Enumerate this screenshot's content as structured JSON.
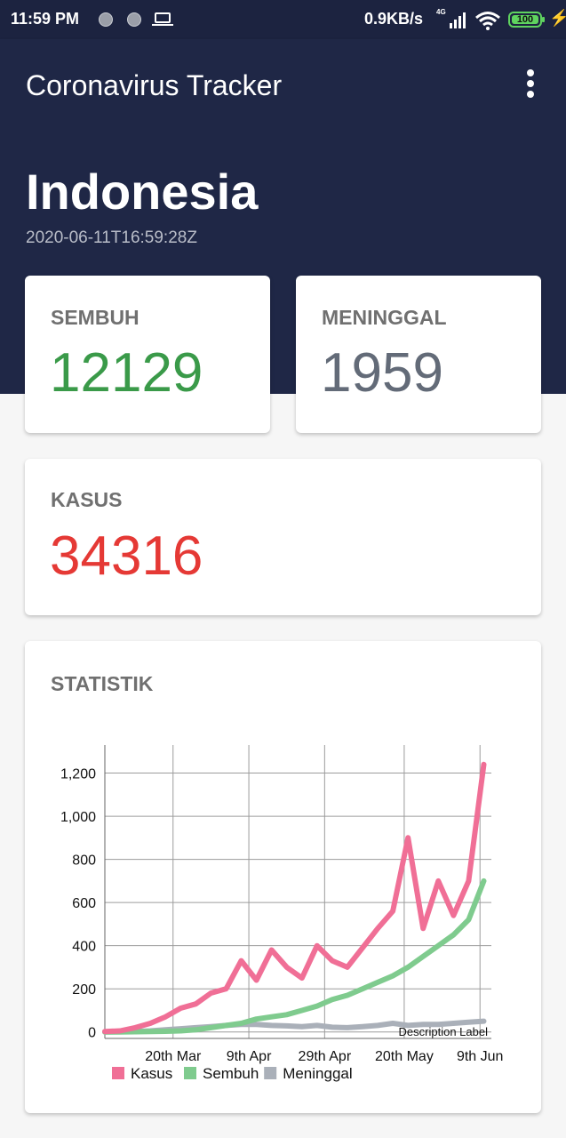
{
  "status_bar": {
    "time": "11:59 PM",
    "speed": "0.9KB/s",
    "network": "4G",
    "battery": "100"
  },
  "app_bar": {
    "title": "Coronavirus Tracker",
    "menu_icon": "more-vert-icon"
  },
  "header": {
    "country": "Indonesia",
    "updated": "2020-06-11T16:59:28Z"
  },
  "stats": {
    "recovered": {
      "label": "SEMBUH",
      "value": "12129",
      "color": "#3a9a49"
    },
    "deaths": {
      "label": "MENINGGAL",
      "value": "1959",
      "color": "#636b78"
    },
    "cases": {
      "label": "KASUS",
      "value": "34316",
      "color": "#e53935"
    }
  },
  "statistics_card": {
    "title": "STATISTIK"
  },
  "chart_data": {
    "type": "line",
    "x": [
      "2020-03-02",
      "2020-03-06",
      "2020-03-10",
      "2020-03-14",
      "2020-03-18",
      "2020-03-22",
      "2020-03-26",
      "2020-03-30",
      "2020-04-03",
      "2020-04-07",
      "2020-04-11",
      "2020-04-15",
      "2020-04-19",
      "2020-04-23",
      "2020-04-27",
      "2020-05-01",
      "2020-05-05",
      "2020-05-09",
      "2020-05-13",
      "2020-05-17",
      "2020-05-21",
      "2020-05-25",
      "2020-05-29",
      "2020-06-02",
      "2020-06-06",
      "2020-06-10"
    ],
    "x_tick_labels": [
      "20th Mar",
      "9th Apr",
      "29th Apr",
      "20th May",
      "9th Jun"
    ],
    "y_tick_labels": [
      "0",
      "200",
      "400",
      "600",
      "800",
      "1,000",
      "1,200"
    ],
    "ylim": [
      -30,
      1330
    ],
    "description": "Description Label",
    "legend_position": "bottom-left",
    "grid": true,
    "series": [
      {
        "name": "Kasus",
        "color": "#f06f96",
        "values": [
          2,
          5,
          20,
          40,
          70,
          110,
          130,
          180,
          200,
          330,
          240,
          380,
          300,
          250,
          400,
          330,
          300,
          390,
          480,
          560,
          900,
          480,
          700,
          540,
          700,
          1240
        ]
      },
      {
        "name": "Sembuh",
        "color": "#7fcb8e",
        "values": [
          0,
          0,
          1,
          2,
          3,
          5,
          10,
          20,
          30,
          40,
          60,
          70,
          80,
          100,
          120,
          150,
          170,
          200,
          230,
          260,
          300,
          350,
          400,
          450,
          520,
          700
        ]
      },
      {
        "name": "Meninggal",
        "color": "#aab0b9",
        "values": [
          0,
          1,
          2,
          5,
          10,
          15,
          20,
          25,
          30,
          35,
          35,
          30,
          28,
          25,
          30,
          22,
          20,
          25,
          30,
          40,
          30,
          35,
          35,
          40,
          45,
          50
        ]
      }
    ]
  }
}
